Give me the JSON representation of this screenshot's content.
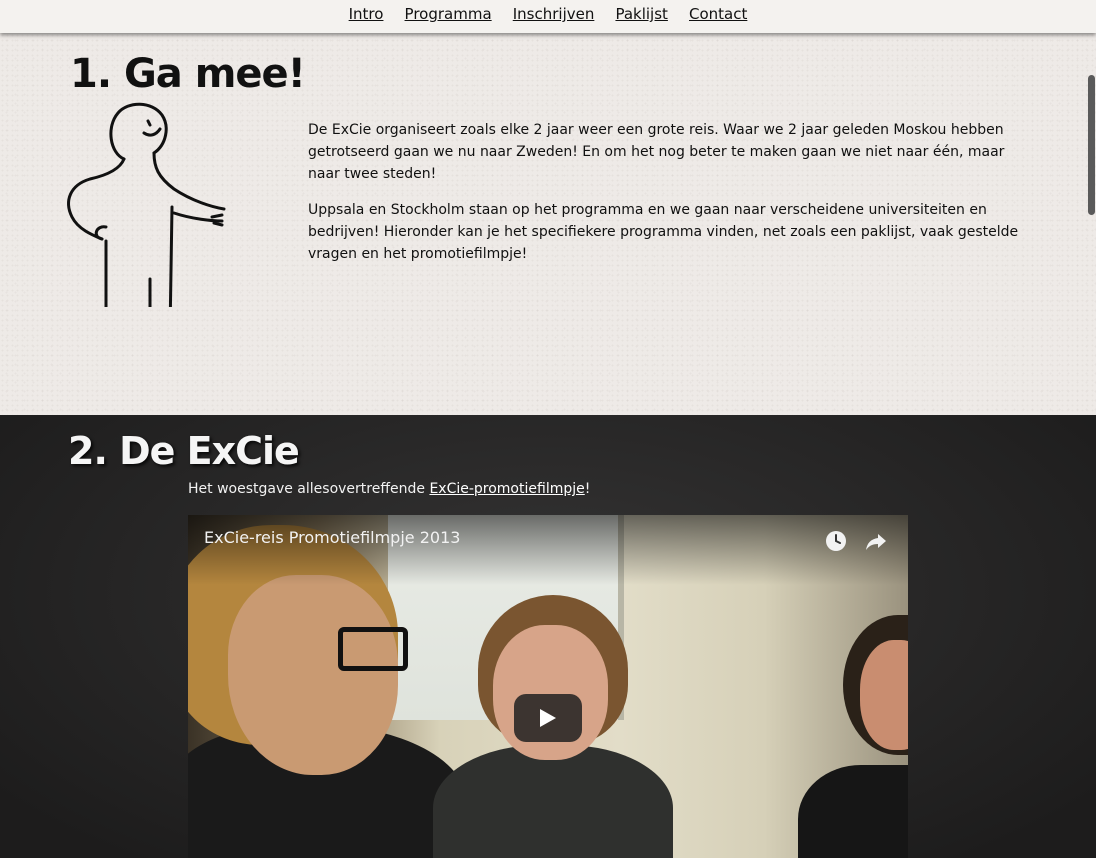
{
  "nav": {
    "items": [
      {
        "label": "Intro"
      },
      {
        "label": "Programma"
      },
      {
        "label": "Inschrijven"
      },
      {
        "label": "Paklijst"
      },
      {
        "label": "Contact"
      }
    ]
  },
  "section1": {
    "title": "1. Ga mee!",
    "paragraphs": [
      "De ExCie organiseert zoals elke 2 jaar weer een grote reis. Waar we 2 jaar geleden Moskou hebben getrotseerd gaan we nu naar Zweden! En om het nog beter te maken gaan we niet naar één, maar naar twee steden!",
      "Uppsala en Stockholm staan op het programma en we gaan naar verscheidene universiteiten en bedrijven! Hieronder kan je het specifiekere programma vinden, net zoals een paklijst, vaak gestelde vragen en het promotiefilmpje!"
    ]
  },
  "section2": {
    "title": "2. De ExCie",
    "lead_before": "Het woestgave allesovertreffende ",
    "lead_link": "ExCie-promotiefilmpje",
    "lead_after": "!"
  },
  "video": {
    "title": "ExCie-reis Promotiefilmpje 2013",
    "icons": [
      "watch-later-icon",
      "share-icon",
      "play-icon"
    ]
  }
}
